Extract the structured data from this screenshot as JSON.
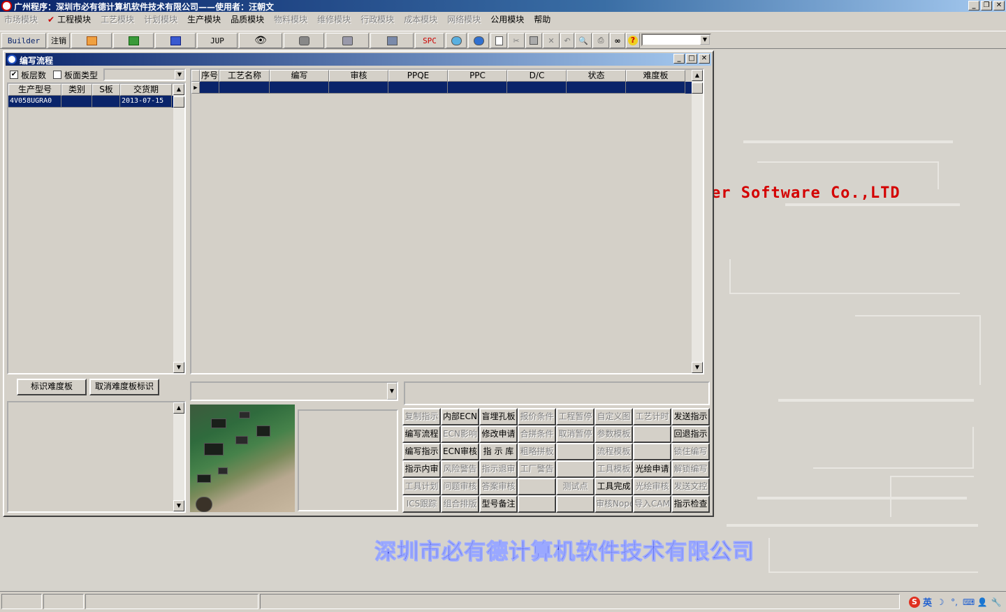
{
  "window": {
    "title": "广州程序：深圳市必有德计算机软件技术有限公司——使用者：汪朝文"
  },
  "menu": [
    {
      "label": "市场模块",
      "disabled": true
    },
    {
      "label": "工程模块",
      "disabled": false,
      "checked": true
    },
    {
      "label": "工艺模块",
      "disabled": true
    },
    {
      "label": "计划模块",
      "disabled": true
    },
    {
      "label": "生产模块",
      "disabled": false
    },
    {
      "label": "品质模块",
      "disabled": false
    },
    {
      "label": "物料模块",
      "disabled": true
    },
    {
      "label": "维修模块",
      "disabled": true
    },
    {
      "label": "行政模块",
      "disabled": true
    },
    {
      "label": "成本模块",
      "disabled": true
    },
    {
      "label": "网络模块",
      "disabled": true
    },
    {
      "label": "公用模块",
      "disabled": false
    },
    {
      "label": "帮助",
      "disabled": false
    }
  ],
  "toolbar": {
    "builder": "Builder",
    "logout": "注销",
    "jup": "JUP",
    "spc": "SPC"
  },
  "child": {
    "title": "编写流程",
    "layer_count_label": "板层数",
    "board_type_label": "板面类型",
    "left_grid": {
      "headers": [
        "生产型号",
        "类别",
        "S板",
        "交货期"
      ],
      "rows": [
        [
          "4V058UGRA0",
          "",
          "",
          "2013-07-15"
        ]
      ]
    },
    "main_grid": {
      "headers": [
        "序号",
        "工艺名称",
        "编写",
        "审核",
        "PPQE",
        "PPC",
        "D/C",
        "状态",
        "难度板"
      ]
    },
    "mark_difficulty_button": "标识难度板",
    "cancel_mark_button": "取消难度板标识",
    "actions": [
      [
        "复制指示",
        "内部ECN",
        "盲埋孔板",
        "报价条件",
        "工程暂停",
        "自定义图",
        "工艺计时",
        "发送指示"
      ],
      [
        "编写流程",
        "ECN影响",
        "修改申请",
        "合拼条件",
        "取消暂停",
        "参数模板",
        "",
        "回退指示"
      ],
      [
        "编写指示",
        "ECN审核",
        "指 示 库",
        "粗略拼板",
        "",
        "流程模板",
        "",
        "锁住编写"
      ],
      [
        "指示内审",
        "风险警告",
        "指示退审",
        "工厂警告",
        "",
        "工具模板",
        "光绘申请",
        "解锁编写"
      ],
      [
        "工具计划",
        "问题审核",
        "答案审核",
        "",
        "测试点",
        "工具完成",
        "光绘审核",
        "发送文控"
      ],
      [
        "ICS跟踪",
        "组合排版",
        "型号备注",
        "",
        "",
        "审核Nope",
        "导入CAM",
        "指示检查"
      ]
    ],
    "disabled_actions": [
      "复制指示",
      "报价条件",
      "工程暂停",
      "自定义图",
      "工艺计时",
      "ECN影响",
      "合拼条件",
      "取消暂停",
      "参数模板",
      "粗略拼板",
      "流程模板",
      "锁住编写",
      "风险警告",
      "指示退审",
      "工厂警告",
      "工具模板",
      "解锁编写",
      "工具计划",
      "问题审核",
      "答案审核",
      "测试点",
      "光绘审核",
      "发送文控",
      "ICS跟踪",
      "组合排版",
      "审核Nope",
      "导入CAM"
    ]
  },
  "background": {
    "company_en": "er Software Co.,LTD",
    "company_cn": "深圳市必有德计算机软件技术有限公司"
  },
  "statusbar": {
    "ime_label": "英"
  },
  "colors": {
    "title_blue": "#0a246a",
    "selection": "#0a246a",
    "logo_red": "#d40000",
    "logo_blue": "#3a46d8"
  }
}
